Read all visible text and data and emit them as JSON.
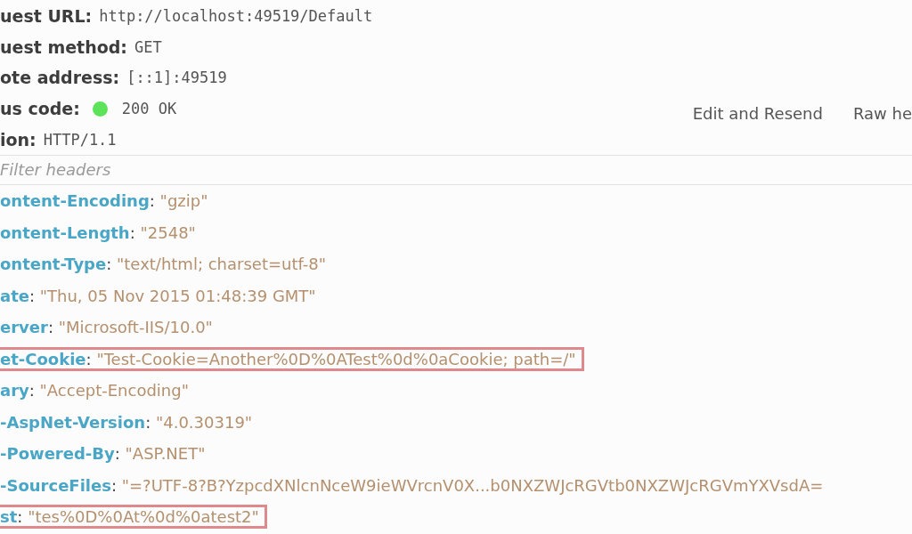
{
  "summary": [
    {
      "label": "uest URL:",
      "value": "http://localhost:49519/Default"
    },
    {
      "label": "uest method:",
      "value": "GET"
    },
    {
      "label": "ote address:",
      "value": "[::1]:49519"
    },
    {
      "label": "us code:",
      "value": "200 OK",
      "kind": "status"
    },
    {
      "label": "ion:",
      "value": "HTTP/1.1"
    }
  ],
  "actions": [
    "Edit and Resend",
    "Raw he"
  ],
  "filter": {
    "placeholder": "Filter headers"
  },
  "headers": [
    {
      "name": "ontent-Encoding",
      "separator": ":",
      "value": "\"gzip\"",
      "highlighted": false
    },
    {
      "name": "ontent-Length",
      "separator": ":",
      "value": "\"2548\"",
      "highlighted": false
    },
    {
      "name": "ontent-Type",
      "separator": ":",
      "value": "\"text/html; charset=utf-8\"",
      "highlighted": false
    },
    {
      "name": "ate",
      "separator": ":",
      "value": "\"Thu, 05 Nov 2015 01:48:39 GMT\"",
      "highlighted": false
    },
    {
      "name": "erver",
      "separator": ":",
      "value": "\"Microsoft-IIS/10.0\"",
      "highlighted": false
    },
    {
      "name": "et-Cookie",
      "separator": ":",
      "value": "\"Test-Cookie=Another%0D%0ATest%0d%0aCookie; path=/\"",
      "highlighted": true
    },
    {
      "name": "ary",
      "separator": ":",
      "value": "\"Accept-Encoding\"",
      "highlighted": false
    },
    {
      "name": "-AspNet-Version",
      "separator": ":",
      "value": "\"4.0.30319\"",
      "highlighted": false
    },
    {
      "name": "-Powered-By",
      "separator": ":",
      "value": "\"ASP.NET\"",
      "highlighted": false
    },
    {
      "name": "-SourceFiles",
      "separator": ":",
      "value": "\"=?UTF-8?B?YzpcdXNlcnNceW9ieWVrcnV0X...b0NXZWJcRGVtb0NXZWJcRGVmYXVsdA=",
      "highlighted": false
    },
    {
      "name": "st",
      "separator": ":",
      "value": "\"tes%0D%0At%0d%0atest2\"",
      "highlighted": true
    }
  ]
}
